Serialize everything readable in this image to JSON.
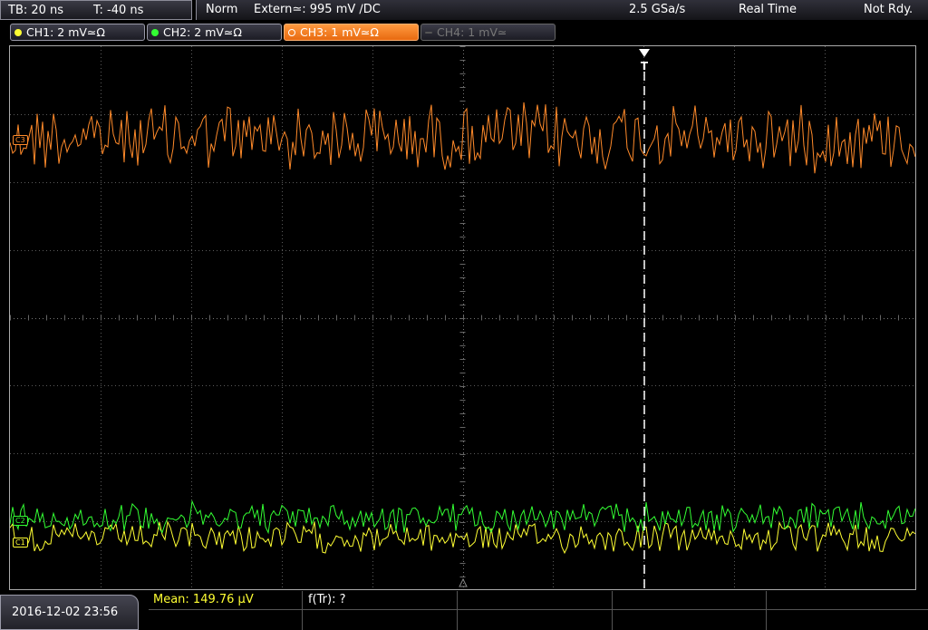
{
  "timebase": {
    "tb": "TB: 20 ns",
    "trig_time": "T: -40 ns"
  },
  "acquisition": {
    "mode": "Norm",
    "trigger": "Extern≃: 995 mV ∕DC",
    "sample_rate": "2.5 GSa/s",
    "realtime": "Real Time",
    "status": "Not Rdy."
  },
  "channels": [
    {
      "label": "CH1: 2 mV≃Ω",
      "color": "#ffff33",
      "state": "on"
    },
    {
      "label": "CH2: 2 mV≃Ω",
      "color": "#33ff33",
      "state": "on"
    },
    {
      "label": "CH3: 1 mV≃Ω",
      "color": "#ff8a2a",
      "state": "active"
    },
    {
      "label": "CH4: 1 mV≃",
      "color": "#777777",
      "state": "off"
    }
  ],
  "markers": {
    "trigger": "T",
    "c3": "C3",
    "c2": "C2",
    "c1": "C1"
  },
  "colors": {
    "ch1": "#ffff33",
    "ch2": "#33ff33",
    "ch3": "#ff8a2a"
  },
  "timestamp": "2016-12-02 23:56",
  "measurements": {
    "mean": "Mean: 149.76 µV",
    "freq": "f(Tr): ?"
  }
}
